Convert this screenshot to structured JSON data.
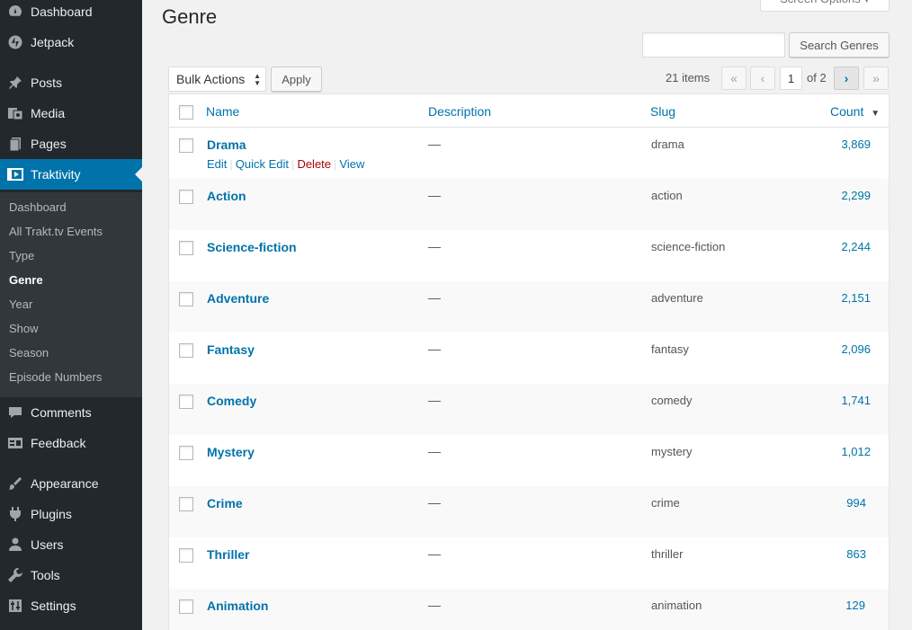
{
  "sidebar": {
    "top": [
      {
        "label": "Dashboard",
        "icon": "dashboard-icon"
      },
      {
        "label": "Jetpack",
        "icon": "jetpack-icon"
      }
    ],
    "content": [
      {
        "label": "Posts",
        "icon": "pin-icon"
      },
      {
        "label": "Media",
        "icon": "media-icon"
      },
      {
        "label": "Pages",
        "icon": "pages-icon"
      },
      {
        "label": "Traktivity",
        "icon": "video-icon"
      }
    ],
    "submenu": [
      {
        "label": "Dashboard"
      },
      {
        "label": "All Trakt.tv Events"
      },
      {
        "label": "Type"
      },
      {
        "label": "Genre"
      },
      {
        "label": "Year"
      },
      {
        "label": "Show"
      },
      {
        "label": "Season"
      },
      {
        "label": "Episode Numbers"
      }
    ],
    "bottom1": [
      {
        "label": "Comments",
        "icon": "comment-icon"
      },
      {
        "label": "Feedback",
        "icon": "feedback-icon"
      }
    ],
    "bottom2": [
      {
        "label": "Appearance",
        "icon": "brush-icon"
      },
      {
        "label": "Plugins",
        "icon": "plugin-icon"
      },
      {
        "label": "Users",
        "icon": "user-icon"
      },
      {
        "label": "Tools",
        "icon": "wrench-icon"
      },
      {
        "label": "Settings",
        "icon": "settings-icon"
      }
    ]
  },
  "page": {
    "title": "Genre",
    "screen_options": "Screen Options ▾"
  },
  "search": {
    "value": "",
    "button": "Search Genres"
  },
  "bulk": {
    "selected": "Bulk Actions",
    "apply": "Apply"
  },
  "pagination": {
    "items": "21 items",
    "first": "«",
    "prev": "‹",
    "current": "1",
    "of": "of 2",
    "next": "›",
    "last": "»"
  },
  "table": {
    "headers": {
      "name": "Name",
      "description": "Description",
      "slug": "Slug",
      "count": "Count"
    },
    "sort_indicator": "▼",
    "row_actions": {
      "edit": "Edit",
      "quick_edit": "Quick Edit",
      "delete": "Delete",
      "view": "View"
    },
    "rows": [
      {
        "name": "Drama",
        "description": "—",
        "slug": "drama",
        "count": "3,869"
      },
      {
        "name": "Action",
        "description": "—",
        "slug": "action",
        "count": "2,299"
      },
      {
        "name": "Science-fiction",
        "description": "—",
        "slug": "science-fiction",
        "count": "2,244"
      },
      {
        "name": "Adventure",
        "description": "—",
        "slug": "adventure",
        "count": "2,151"
      },
      {
        "name": "Fantasy",
        "description": "—",
        "slug": "fantasy",
        "count": "2,096"
      },
      {
        "name": "Comedy",
        "description": "—",
        "slug": "comedy",
        "count": "1,741"
      },
      {
        "name": "Mystery",
        "description": "—",
        "slug": "mystery",
        "count": "1,012"
      },
      {
        "name": "Crime",
        "description": "—",
        "slug": "crime",
        "count": "994"
      },
      {
        "name": "Thriller",
        "description": "—",
        "slug": "thriller",
        "count": "863"
      },
      {
        "name": "Animation",
        "description": "—",
        "slug": "animation",
        "count": "129"
      }
    ]
  }
}
